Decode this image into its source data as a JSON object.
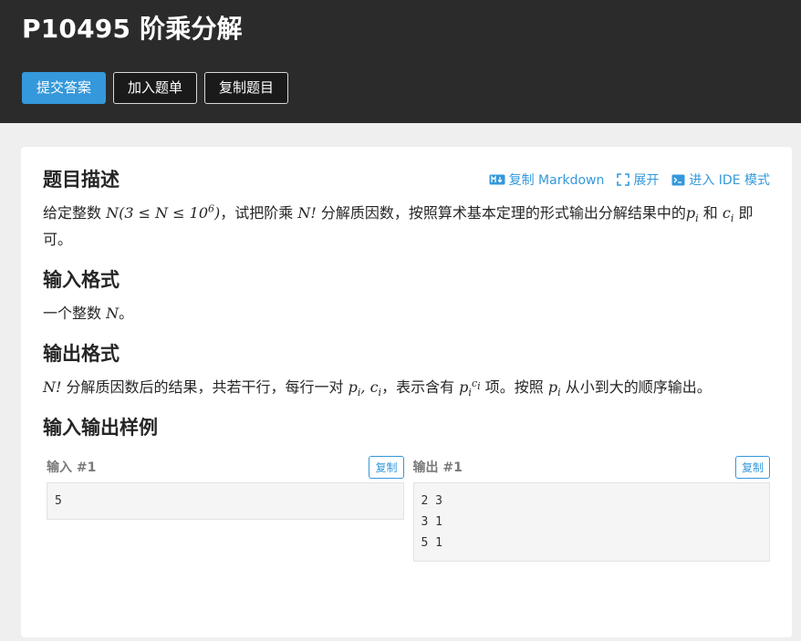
{
  "problem": {
    "title": "P10495 阶乘分解"
  },
  "actions": {
    "submit": "提交答案",
    "add_list": "加入题单",
    "copy_problem": "复制题目"
  },
  "tools": {
    "copy_markdown": "复制 Markdown",
    "expand": "展开",
    "ide_mode": "进入 IDE 模式"
  },
  "description": {
    "heading": "题目描述",
    "t1": "给定整数 ",
    "m1": "N(3 ≤ N ≤ 10",
    "m1_sup": "6",
    "m1_end": ")",
    "t2": "，试把阶乘 ",
    "m2": "N!",
    "t3": " 分解质因数，按照算术基本定理的形式输出分解结果中的",
    "m3": "p",
    "m3_sub": "i",
    "t4": " 和 ",
    "m4": "c",
    "m4_sub": "i",
    "t5": " 即可。"
  },
  "input_format": {
    "heading": "输入格式",
    "t1": "一个整数 ",
    "m1": "N",
    "t2": "。"
  },
  "output_format": {
    "heading": "输出格式",
    "m1": "N!",
    "t1": " 分解质因数后的结果，共若干行，每行一对 ",
    "m2": "p",
    "m2_sub": "i",
    "m2b": ", c",
    "m2b_sub": "i",
    "t2": "，表示含有 ",
    "m3": "p",
    "m3_sub": "i",
    "m3_sup": "c",
    "m3_sup_sub": "i",
    "t3": " 项。按照 ",
    "m4": "p",
    "m4_sub": "i",
    "t4": " 从小到大的顺序输出。"
  },
  "samples": {
    "heading": "输入输出样例",
    "input_label": "输入 #1",
    "output_label": "输出 #1",
    "copy": "复制",
    "input_lines": [
      "5"
    ],
    "output_lines": [
      "2 3",
      "3 1",
      "5 1"
    ]
  },
  "colors": {
    "accent": "#3498db",
    "header_bg": "#2b2b2b"
  },
  "icons": {
    "markdown": "markdown-icon",
    "expand": "expand-icon",
    "terminal": "terminal-icon"
  }
}
